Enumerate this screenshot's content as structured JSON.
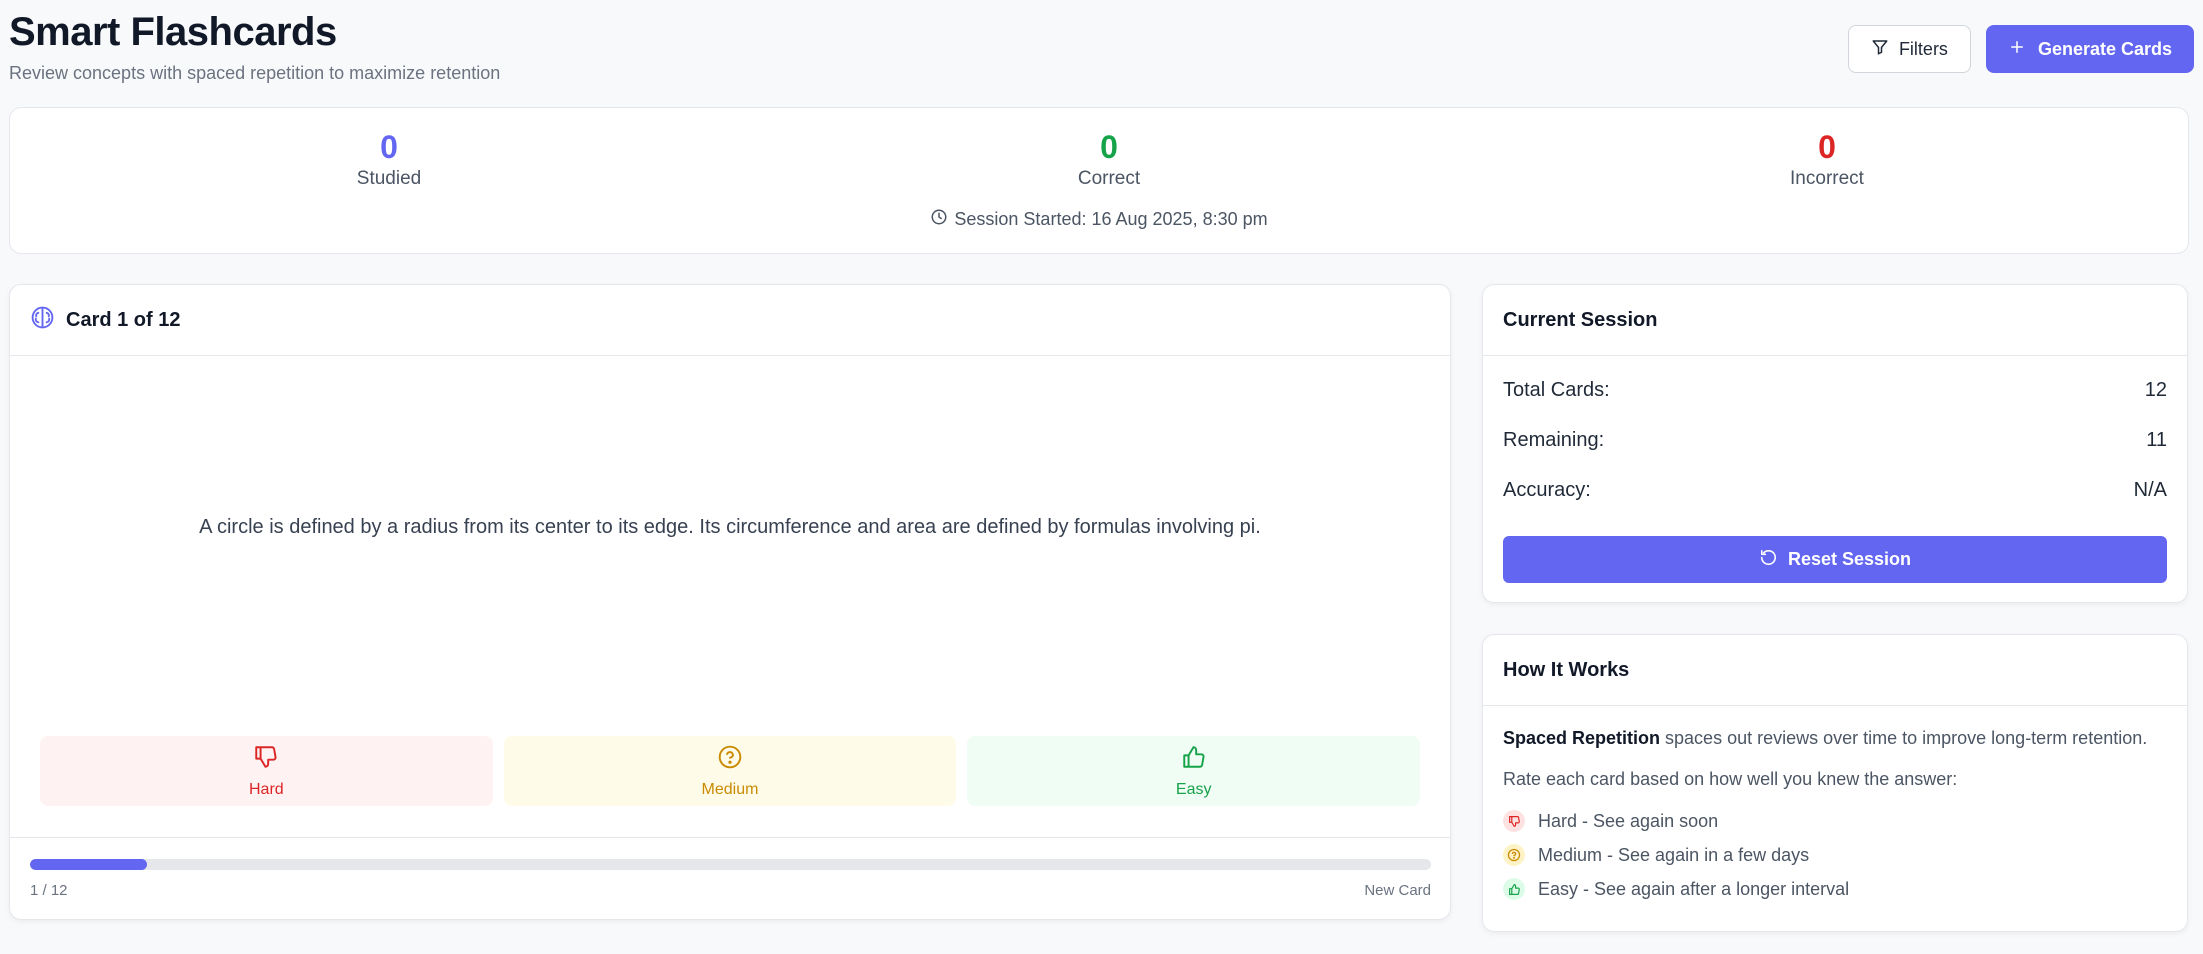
{
  "header": {
    "title": "Smart Flashcards",
    "subtitle": "Review concepts with spaced repetition to maximize retention",
    "filters_label": "Filters",
    "generate_label": "Generate Cards"
  },
  "stats": {
    "studied": {
      "value": "0",
      "label": "Studied"
    },
    "correct": {
      "value": "0",
      "label": "Correct"
    },
    "incorrect": {
      "value": "0",
      "label": "Incorrect"
    },
    "session_started": "Session Started: 16 Aug 2025, 8:30 pm"
  },
  "card": {
    "title": "Card 1 of 12",
    "text": "A circle is defined by a radius from its center to its edge. Its circumference and area are defined by formulas involving pi.",
    "ratings": {
      "hard": "Hard",
      "medium": "Medium",
      "easy": "Easy"
    },
    "progress_label": "1 / 12",
    "progress_fraction": 0.0833,
    "status": "New Card"
  },
  "session": {
    "title": "Current Session",
    "rows": [
      {
        "label": "Total Cards:",
        "value": "12"
      },
      {
        "label": "Remaining:",
        "value": "11"
      },
      {
        "label": "Accuracy:",
        "value": "N/A"
      }
    ],
    "reset_label": "Reset Session"
  },
  "how_it_works": {
    "title": "How It Works",
    "intro_bold": "Spaced Repetition",
    "intro_rest": " spaces out reviews over time to improve long-term retention.",
    "instruction": "Rate each card based on how well you knew the answer:",
    "legend": [
      "Hard - See again soon",
      "Medium - See again in a few days",
      "Easy - See again after a longer interval"
    ]
  },
  "colors": {
    "accent": "#6366f1",
    "correct": "#16a34a",
    "incorrect": "#dc2626",
    "medium": "#ca8a04"
  }
}
